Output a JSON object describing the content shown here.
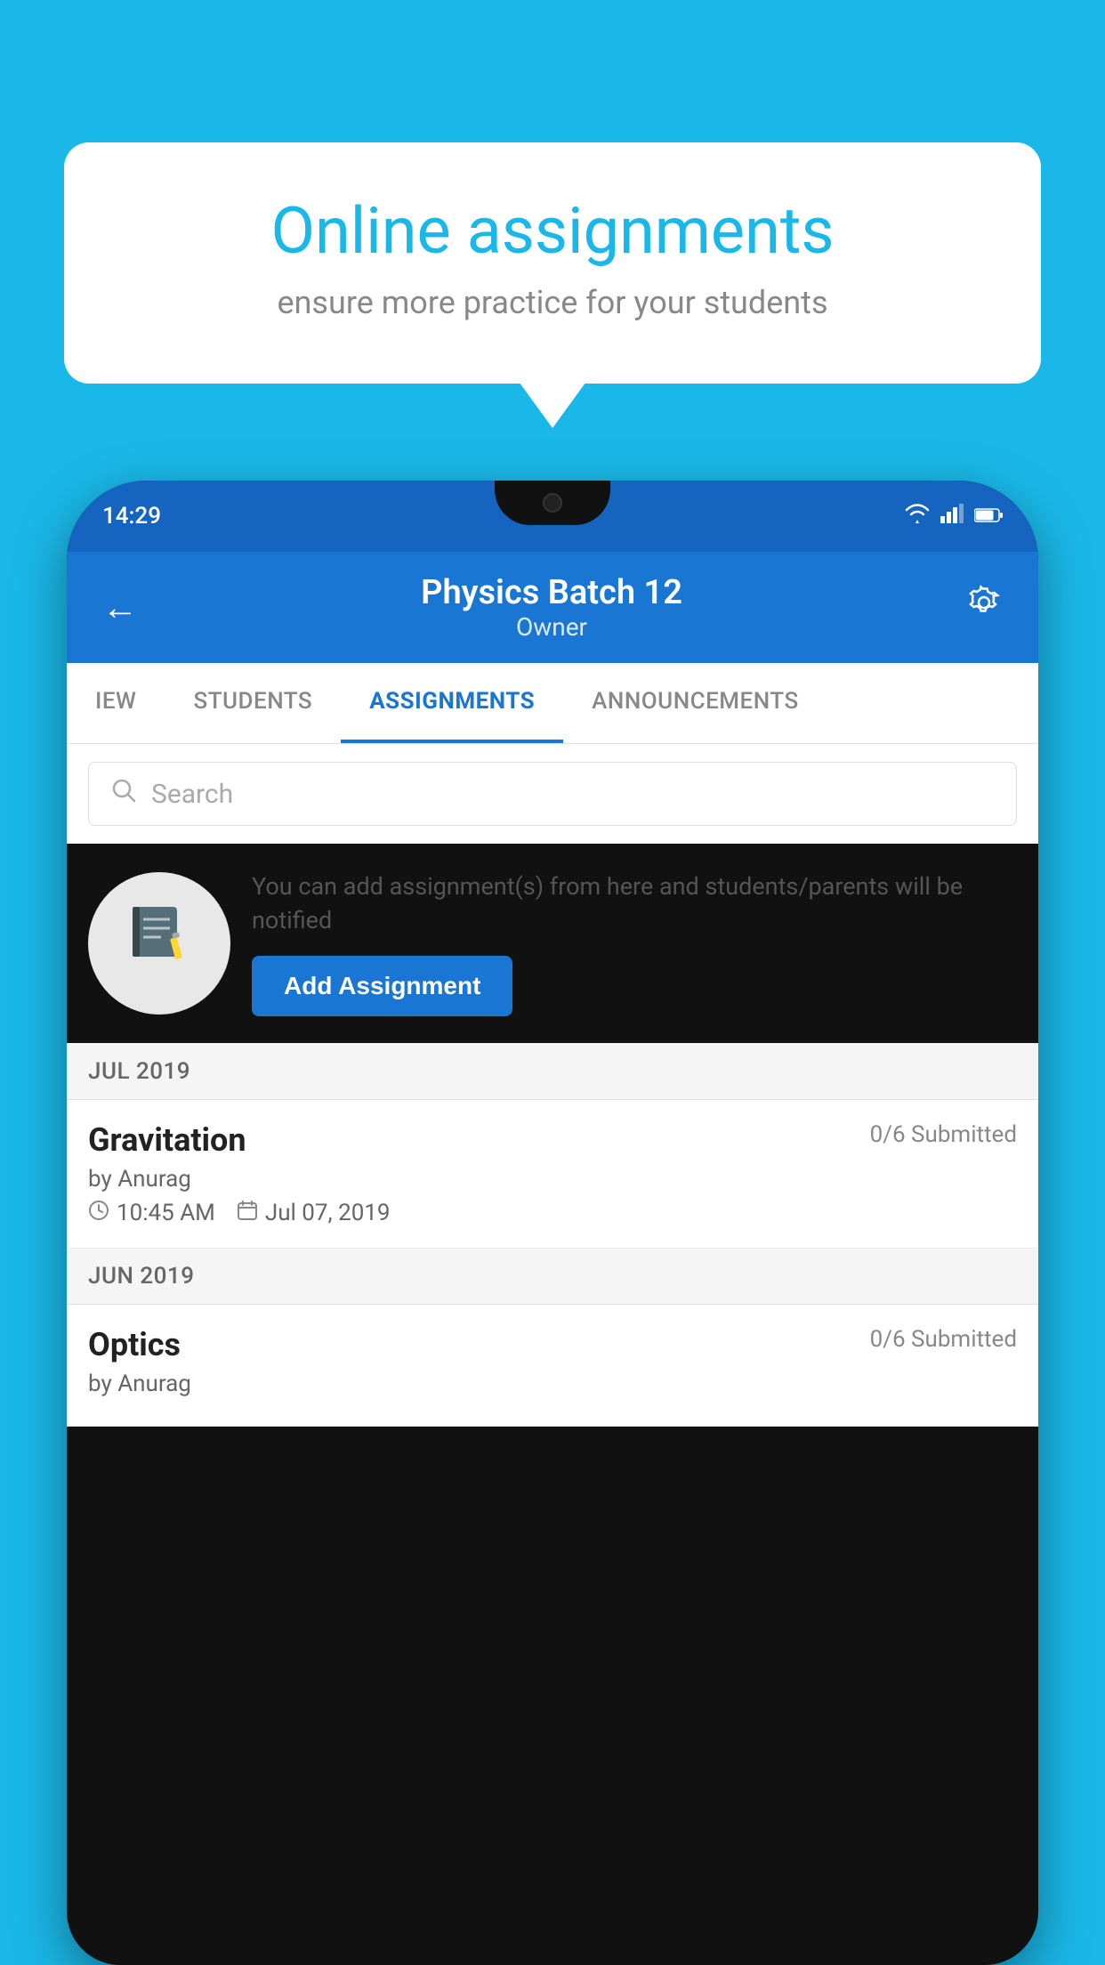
{
  "background_color": "#1ab8e8",
  "speech_bubble": {
    "title": "Online assignments",
    "subtitle": "ensure more practice for your students"
  },
  "phone": {
    "status_bar": {
      "time": "14:29",
      "icons": [
        "wifi",
        "signal",
        "battery"
      ]
    },
    "header": {
      "title": "Physics Batch 12",
      "subtitle": "Owner"
    },
    "tabs": [
      {
        "label": "IEW",
        "active": false
      },
      {
        "label": "STUDENTS",
        "active": false
      },
      {
        "label": "ASSIGNMENTS",
        "active": true
      },
      {
        "label": "ANNOUNCEMENTS",
        "active": false
      }
    ],
    "search": {
      "placeholder": "Search"
    },
    "add_assignment_section": {
      "description": "You can add assignment(s) from here and students/parents will be notified",
      "button_label": "Add Assignment"
    },
    "assignment_groups": [
      {
        "month": "JUL 2019",
        "assignments": [
          {
            "name": "Gravitation",
            "submitted": "0/6 Submitted",
            "by": "by Anurag",
            "time": "10:45 AM",
            "date": "Jul 07, 2019"
          }
        ]
      },
      {
        "month": "JUN 2019",
        "assignments": [
          {
            "name": "Optics",
            "submitted": "0/6 Submitted",
            "by": "by Anurag",
            "time": "",
            "date": ""
          }
        ]
      }
    ]
  }
}
